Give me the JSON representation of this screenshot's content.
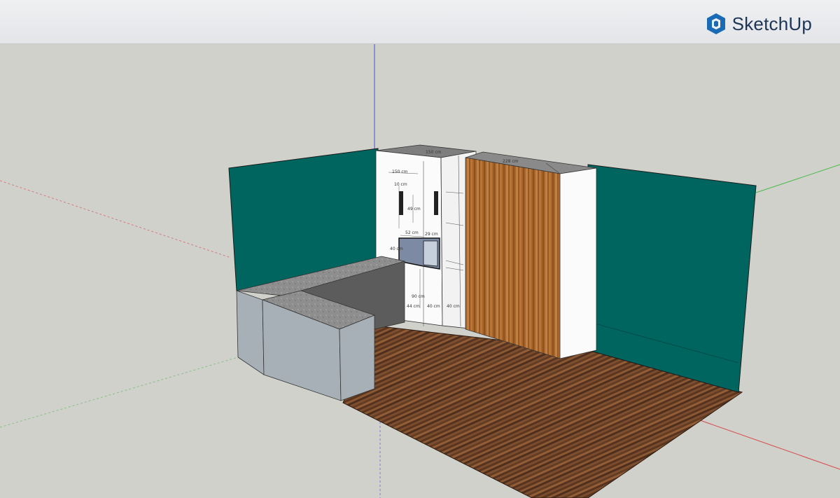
{
  "app": {
    "name": "SketchUp",
    "logo_icon": "sketchup-logo-icon"
  },
  "colors": {
    "wall": "#00645f",
    "cabinet": "#fbfbfb",
    "counter": "#8e8e8e",
    "base": "#a7b0b7",
    "floor": "#6b4228",
    "door": "#a8652a",
    "background": "#d1d1cc"
  },
  "dimensions": {
    "top_width": "150 cm",
    "upper_width": "150 cm",
    "inner_width": "10 cm",
    "niche_height": "49 cm",
    "shelf_width": "52 cm",
    "side_depth": "29 cm",
    "oven_height": "40 cm",
    "base_height": "90 cm",
    "base_depth": "44 cm",
    "base_width_1": "40 cm",
    "base_width_2": "40 cm",
    "wardrobe_width": "228 cm"
  }
}
